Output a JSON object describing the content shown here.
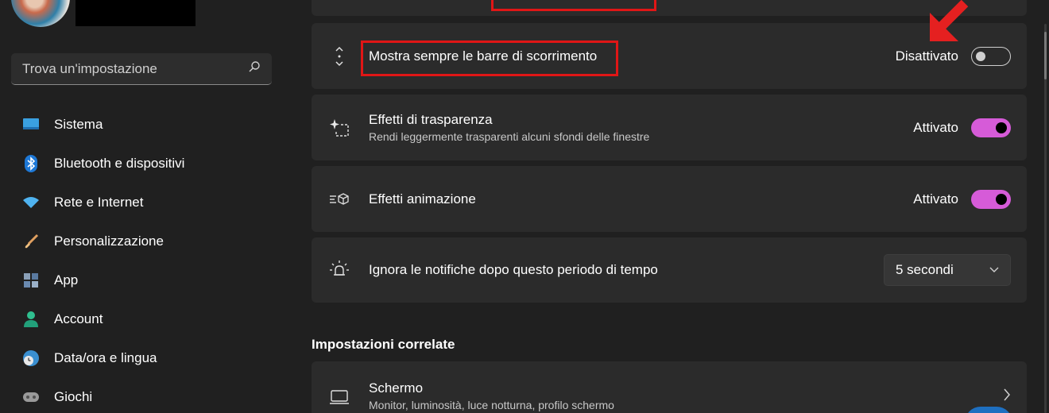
{
  "search": {
    "placeholder": "Trova un'impostazione"
  },
  "sidebar": {
    "items": [
      {
        "label": "Sistema",
        "icon": "monitor-icon"
      },
      {
        "label": "Bluetooth e dispositivi",
        "icon": "bluetooth-icon"
      },
      {
        "label": "Rete e Internet",
        "icon": "wifi-icon"
      },
      {
        "label": "Personalizzazione",
        "icon": "brush-icon"
      },
      {
        "label": "App",
        "icon": "apps-icon"
      },
      {
        "label": "Account",
        "icon": "person-icon"
      },
      {
        "label": "Data/ora e lingua",
        "icon": "globe-clock-icon"
      },
      {
        "label": "Giochi",
        "icon": "gamepad-icon"
      }
    ]
  },
  "settings": {
    "scrollbars": {
      "title": "Mostra sempre le barre di scorrimento",
      "state": "Disattivato",
      "on": false
    },
    "transparency": {
      "title": "Effetti di trasparenza",
      "subtitle": "Rendi leggermente trasparenti alcuni sfondi delle finestre",
      "state": "Attivato",
      "on": true
    },
    "animation": {
      "title": "Effetti animazione",
      "state": "Attivato",
      "on": true
    },
    "notifications": {
      "title": "Ignora le notifiche dopo questo periodo di tempo",
      "value": "5 secondi"
    }
  },
  "related": {
    "heading": "Impostazioni correlate",
    "display": {
      "title": "Schermo",
      "subtitle": "Monitor, luminosità, luce notturna, profilo schermo"
    }
  },
  "colors": {
    "accent": "#d65bd8",
    "highlight": "#e01616",
    "background": "#202020",
    "card": "#2b2b2b"
  }
}
